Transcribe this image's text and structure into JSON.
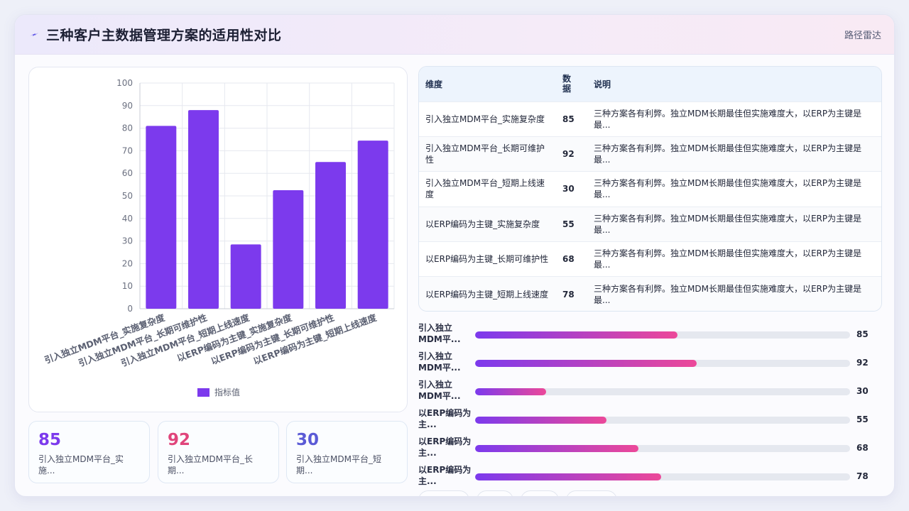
{
  "header": {
    "title": "三种客户主数据管理方案的适用性对比",
    "badge": "路径雷达"
  },
  "chart_data": {
    "type": "bar",
    "categories": [
      "引入独立MDM平台_实施复杂度",
      "引入独立MDM平台_长期可维护性",
      "引入独立MDM平台_短期上线速度",
      "以ERP编码为主键_实施复杂度",
      "以ERP编码为主键_长期可维护性",
      "以ERP编码为主键_短期上线速度"
    ],
    "values": [
      81,
      88,
      28.5,
      52.5,
      65,
      74.5
    ],
    "series": [
      {
        "name": "指标值"
      }
    ],
    "ylim": [
      0,
      100
    ],
    "yticks": [
      0,
      10,
      20,
      30,
      40,
      50,
      60,
      70,
      80,
      90,
      100
    ],
    "grid": true,
    "legend": "bottom",
    "bar_color": "#7c3aed"
  },
  "stats": [
    {
      "value": "85",
      "label_line1": "引入独立MDM平台_实",
      "label_line2": "施...",
      "color": "#7c3aed"
    },
    {
      "value": "92",
      "label_line1": "引入独立MDM平台_长",
      "label_line2": "期...",
      "color": "#e0457b"
    },
    {
      "value": "30",
      "label_line1": "引入独立MDM平台_短",
      "label_line2": "期...",
      "color": "#5b5bd6"
    }
  ],
  "table": {
    "headers": {
      "dimension": "维度",
      "value_line1": "数",
      "value_line2": "据",
      "note": "说明"
    },
    "rows": [
      {
        "dim_line1": "引入独立MDM平台_实施复杂度",
        "dim_line2": "",
        "value": "85",
        "note_line1": "三种方案各有利弊。独立MDM长期最佳但实施难度大，以ERP为主键是",
        "note_line2": "最..."
      },
      {
        "dim_line1": "引入独立MDM平台_长期可维护",
        "dim_line2": "性",
        "value": "92",
        "note_line1": "三种方案各有利弊。独立MDM长期最佳但实施难度大，以ERP为主键是",
        "note_line2": "最..."
      },
      {
        "dim_line1": "引入独立MDM平台_短期上线速",
        "dim_line2": "度",
        "value": "30",
        "note_line1": "三种方案各有利弊。独立MDM长期最佳但实施难度大，以ERP为主键是",
        "note_line2": "最..."
      },
      {
        "dim_line1": "以ERP编码为主键_实施复杂度",
        "dim_line2": "",
        "value": "55",
        "note_line1": "三种方案各有利弊。独立MDM长期最佳但实施难度大，以ERP为主键是",
        "note_line2": "最..."
      },
      {
        "dim_line1": "以ERP编码为主键_长期可维护性",
        "dim_line2": "",
        "value": "68",
        "note_line1": "三种方案各有利弊。独立MDM长期最佳但实施难度大，以ERP为主键是",
        "note_line2": "最..."
      },
      {
        "dim_line1": "以ERP编码为主键_短期上线速度",
        "dim_line2": "",
        "value": "78",
        "note_line1": "三种方案各有利弊。独立MDM长期最佳但实施难度大，以ERP为主键是",
        "note_line2": "最..."
      }
    ]
  },
  "progress": [
    {
      "label_line1": "引入独立",
      "label_line2": "MDM平...",
      "value": "85",
      "fill": 0.54
    },
    {
      "label_line1": "引入独立",
      "label_line2": "MDM平...",
      "value": "92",
      "fill": 0.59
    },
    {
      "label_line1": "引入独立",
      "label_line2": "MDM平...",
      "value": "30",
      "fill": 0.19
    },
    {
      "label_line1": "以ERP编码为",
      "label_line2": "主...",
      "value": "55",
      "fill": 0.35
    },
    {
      "label_line1": "以ERP编码为",
      "label_line2": "主...",
      "value": "68",
      "fill": 0.435
    },
    {
      "label_line1": "以ERP编码为",
      "label_line2": "主...",
      "value": "78",
      "fill": 0.497
    }
  ]
}
